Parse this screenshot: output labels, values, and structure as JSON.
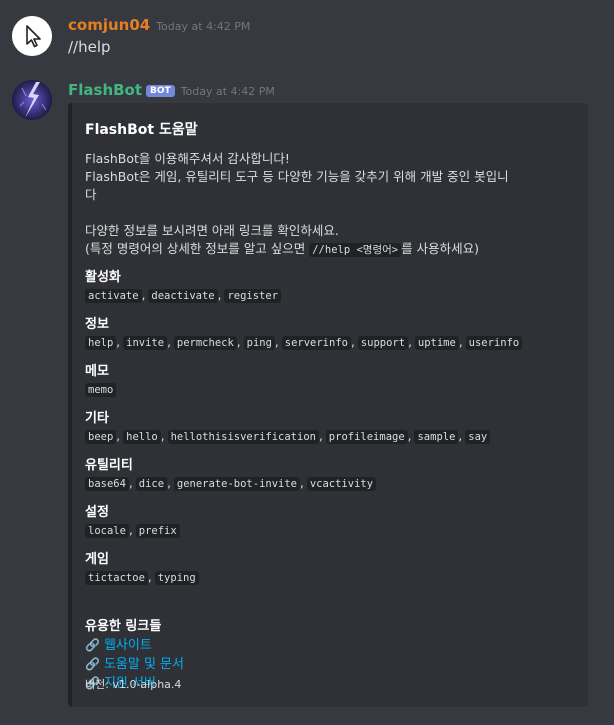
{
  "messages": [
    {
      "username": "comjun04",
      "timestamp": "Today at 4:42 PM",
      "avatar_icon": "cursor-arrow-icon",
      "text": "//help"
    },
    {
      "username": "FlashBot",
      "badge": "BOT",
      "timestamp": "Today at 4:42 PM",
      "avatar_icon": "lightning-icon"
    }
  ],
  "embed": {
    "title": "FlashBot 도움말",
    "description": [
      "FlashBot을 이용해주셔서 감사합니다!",
      "FlashBot은 게임, 유틸리티 도구 등 다양한 기능을 갖추기 위해 개발 중인 봇입니",
      "다",
      "",
      "다양한 정보를 보시려면 아래 링크를 확인하세요."
    ],
    "desc_line6_prefix": "(특정 명령어의 상세한 정보를 알고 싶으면",
    "desc_line6_code": "//help <명령어>",
    "desc_line6_suffix": "를 사용하세요)",
    "fields": [
      {
        "name": "활성화",
        "commands": [
          "activate",
          "deactivate",
          "register"
        ]
      },
      {
        "name": "정보",
        "commands": [
          "help",
          "invite",
          "permcheck",
          "ping",
          "serverinfo",
          "support",
          "uptime",
          "userinfo"
        ]
      },
      {
        "name": "메모",
        "commands": [
          "memo"
        ]
      },
      {
        "name": "기타",
        "commands": [
          "beep",
          "hello",
          "hellothisisverification",
          "profileimage",
          "sample",
          "say"
        ]
      },
      {
        "name": "유틸리티",
        "commands": [
          "base64",
          "dice",
          "generate-bot-invite",
          "vcactivity"
        ]
      },
      {
        "name": "설정",
        "commands": [
          "locale",
          "prefix"
        ]
      },
      {
        "name": "게임",
        "commands": [
          "tictactoe",
          "typing"
        ]
      }
    ],
    "links_title": "유용한 링크들",
    "links": [
      {
        "icon": "link-icon",
        "label": "웹사이트"
      },
      {
        "icon": "link-icon",
        "label": "도움말 및 문서"
      },
      {
        "icon": "link-icon",
        "label": "지원 서버"
      }
    ],
    "footer": "버전: v1.0-alpha.4"
  },
  "colors": {
    "background": "#36393f",
    "embed_bg": "#2f3136",
    "user1": "#e67e22",
    "user2": "#43b581",
    "bot_badge": "#7289da",
    "link": "#00b0f4"
  }
}
